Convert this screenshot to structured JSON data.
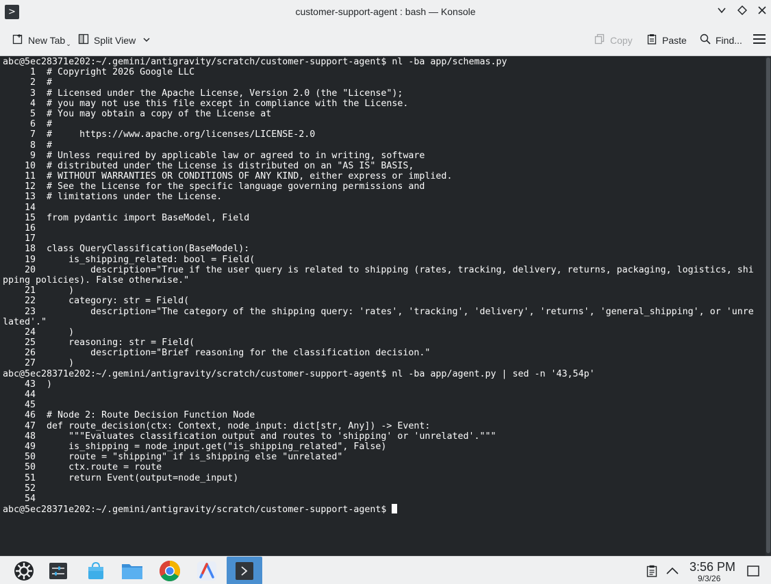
{
  "window": {
    "title": "customer-support-agent : bash — Konsole",
    "app_icon": "terminal-icon",
    "controls": [
      "chevron-down-icon",
      "diamond-icon",
      "close-icon"
    ]
  },
  "toolbar": {
    "new_tab": "New Tab",
    "split_view": "Split View",
    "copy": "Copy",
    "paste": "Paste",
    "find": "Find..."
  },
  "terminal": {
    "lines": [
      "abc@5ec28371e202:~/.gemini/antigravity/scratch/customer-support-agent$ nl -ba app/schemas.py",
      "     1\t# Copyright 2026 Google LLC",
      "     2\t#",
      "     3\t# Licensed under the Apache License, Version 2.0 (the \"License\");",
      "     4\t# you may not use this file except in compliance with the License.",
      "     5\t# You may obtain a copy of the License at",
      "     6\t#",
      "     7\t#     https://www.apache.org/licenses/LICENSE-2.0",
      "     8\t#",
      "     9\t# Unless required by applicable law or agreed to in writing, software",
      "    10\t# distributed under the License is distributed on an \"AS IS\" BASIS,",
      "    11\t# WITHOUT WARRANTIES OR CONDITIONS OF ANY KIND, either express or implied.",
      "    12\t# See the License for the specific language governing permissions and",
      "    13\t# limitations under the License.",
      "    14\t",
      "    15\tfrom pydantic import BaseModel, Field",
      "    16\t",
      "    17\t",
      "    18\tclass QueryClassification(BaseModel):",
      "    19\t    is_shipping_related: bool = Field(",
      "    20\t        description=\"True if the user query is related to shipping (rates, tracking, delivery, returns, packaging, logistics, shi",
      "pping policies). False otherwise.\"",
      "    21\t    )",
      "    22\t    category: str = Field(",
      "    23\t        description=\"The category of the shipping query: 'rates', 'tracking', 'delivery', 'returns', 'general_shipping', or 'unre",
      "lated'.\"",
      "    24\t    )",
      "    25\t    reasoning: str = Field(",
      "    26\t        description=\"Brief reasoning for the classification decision.\"",
      "    27\t    )",
      "abc@5ec28371e202:~/.gemini/antigravity/scratch/customer-support-agent$ nl -ba app/agent.py | sed -n '43,54p'",
      "    43\t)",
      "    44\t",
      "    45\t",
      "    46\t# Node 2: Route Decision Function Node",
      "    47\tdef route_decision(ctx: Context, node_input: dict[str, Any]) -> Event:",
      "    48\t    \"\"\"Evaluates classification output and routes to 'shipping' or 'unrelated'.\"\"\"",
      "    49\t    is_shipping = node_input.get(\"is_shipping_related\", False)",
      "    50\t    route = \"shipping\" if is_shipping else \"unrelated\"",
      "    50\t    ctx.route = route",
      "    51\t    return Event(output=node_input)",
      "    52\t",
      "    54\t"
    ],
    "prompt": "abc@5ec28371e202:~/.gemini/antigravity/scratch/customer-support-agent$ "
  },
  "taskbar": {
    "apps": [
      {
        "name": "app-launcher-icon"
      },
      {
        "name": "system-settings-icon"
      },
      {
        "name": "discover-store-icon"
      },
      {
        "name": "file-manager-icon"
      },
      {
        "name": "chrome-icon"
      },
      {
        "name": "antigravity-icon"
      },
      {
        "name": "konsole-icon",
        "active": true
      }
    ],
    "tray": [
      "clipboard-icon",
      "chevron-up-icon",
      "show-desktop-icon"
    ],
    "time": "3:56 PM",
    "date": "9/3/26"
  },
  "colors": {
    "terminal_bg": "#232629",
    "terminal_fg": "#fcfcfc",
    "chrome_bg": "#eff0f1",
    "active_task": "#4a8fd0"
  }
}
